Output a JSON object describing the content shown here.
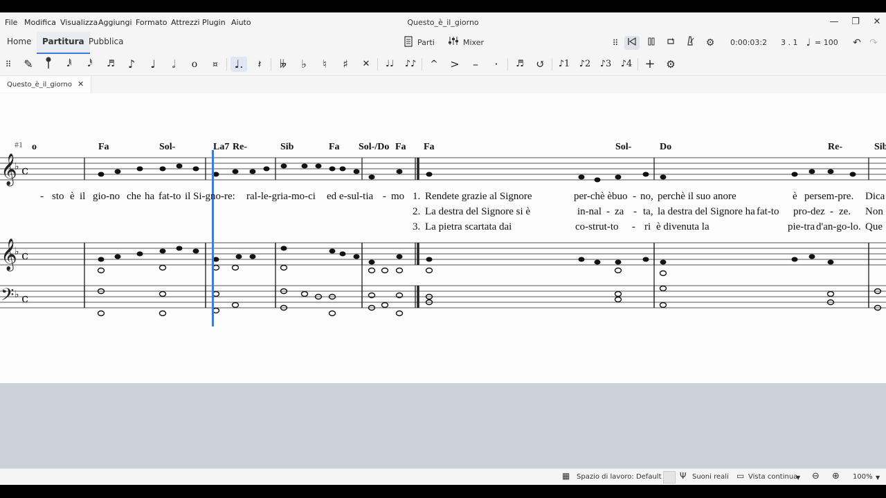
{
  "window": {
    "title": "Questo_è_il_giorno",
    "minimize": "—",
    "maximize": "❐",
    "close": "✕"
  },
  "menu": [
    "File",
    "Modifica",
    "Visualizza",
    "Aggiungi",
    "Formato",
    "Attrezzi",
    "Plugin",
    "Aiuto"
  ],
  "nav_tabs": [
    "Home",
    "Partitura",
    "Pubblica"
  ],
  "toolbar": {
    "parts_label": "Parti",
    "mixer_label": "Mixer",
    "time": "0:00:03:2",
    "position": "3 . 1",
    "tempo": "= 100"
  },
  "doc_tab": {
    "label": "Questo_è_il_giorno",
    "close": "✕"
  },
  "score": {
    "measure_number": "#1",
    "chords": [
      "o",
      "Fa",
      "Sol-",
      "La7",
      "Re-",
      "Sib",
      "Fa",
      "Sol-/Do",
      "Fa",
      "Fa",
      "Sol-",
      "Do",
      "Re-",
      "Sib"
    ],
    "lyrics_line1": [
      "-",
      "sto",
      "è",
      "il",
      "gio-no",
      "che",
      "ha",
      "fat-to",
      "il",
      "Si-gno-re:",
      "ral-le-gria-mo-ci",
      "ed",
      "e-sul-tia",
      "-",
      "mo"
    ],
    "verses": [
      {
        "num": "1.",
        "parts": [
          "Rendete grazie al Signore",
          "per-chè è",
          "buo",
          "-",
          "no,",
          "perchè il suo anore",
          "è",
          "persem-pre.",
          "Dica"
        ]
      },
      {
        "num": "2.",
        "parts": [
          "La destra del Signore si è",
          "in-nal",
          "-",
          "za",
          "-",
          "ta,",
          "la destra del Signore ha",
          "fat-to",
          "pro-dez",
          "-",
          "ze.",
          "Non"
        ]
      },
      {
        "num": "3.",
        "parts": [
          "La pietra scartata dai",
          "co-strut-to",
          "-",
          "ri",
          "è divenuta la",
          "pie-tra",
          "d'an-go-lo.",
          "Que"
        ]
      }
    ]
  },
  "status": {
    "workspace": "Spazio di lavoro: Default",
    "real_sounds": "Suoni reali",
    "view_mode": "Vista continua",
    "zoom": "100%"
  }
}
